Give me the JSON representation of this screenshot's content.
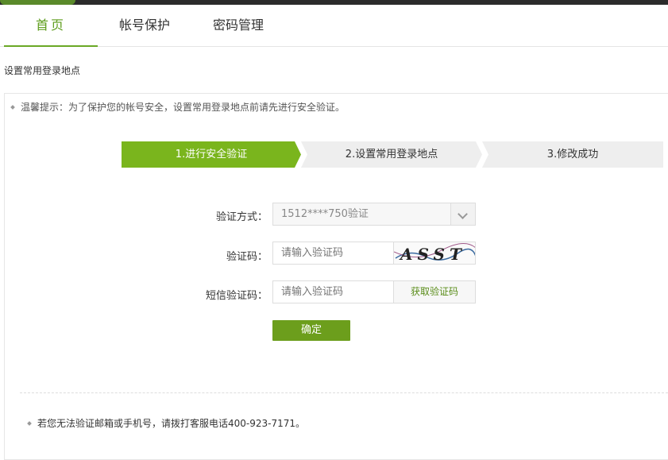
{
  "tabs": [
    {
      "label": "首页",
      "active": true
    },
    {
      "label": "帐号保护",
      "active": false
    },
    {
      "label": "密码管理",
      "active": false
    }
  ],
  "page_title": "设置常用登录地点",
  "tip": "温馨提示：为了保护您的帐号安全，设置常用登录地点前请先进行安全验证。",
  "steps": [
    {
      "label": "1.进行安全验证",
      "active": true
    },
    {
      "label": "2.设置常用登录地点",
      "active": false
    },
    {
      "label": "3.修改成功",
      "active": false
    }
  ],
  "form": {
    "method_label": "验证方式：",
    "method_value": "1512****750验证",
    "captcha_label": "验证码：",
    "captcha_placeholder": "请输入验证码",
    "captcha_image_text": "ASST",
    "sms_label": "短信验证码：",
    "sms_placeholder": "请输入验证码",
    "sms_button": "获取验证码",
    "submit": "确定"
  },
  "footer_tip": "若您无法验证邮箱或手机号，请拨打客服电话400-923-7171。",
  "colors": {
    "accent": "#7ab51d",
    "button": "#6c9e1c",
    "tab_active": "#5c9c1a"
  }
}
